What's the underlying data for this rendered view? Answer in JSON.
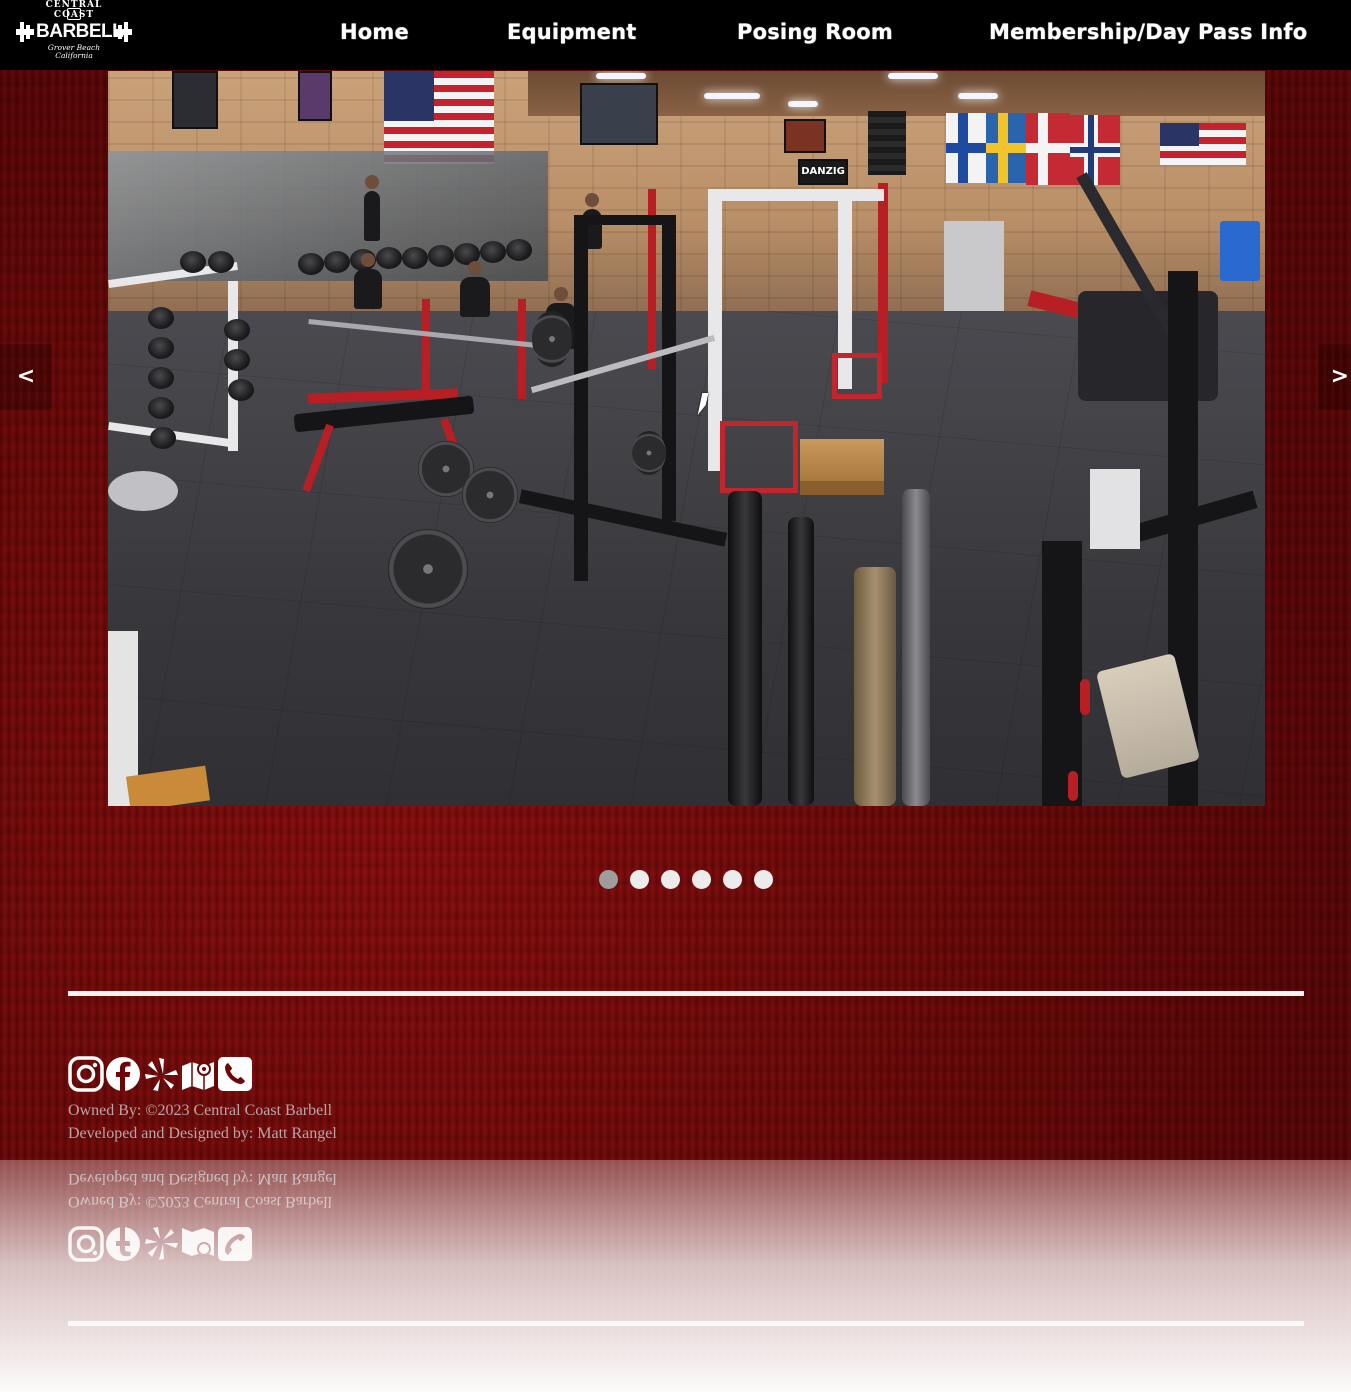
{
  "header": {
    "logo": {
      "arc_text": "CENTRAL COAST",
      "main_text": "BARBELL",
      "sub_text": "Grover Beach California"
    },
    "nav": [
      {
        "label": "Home"
      },
      {
        "label": "Equipment"
      },
      {
        "label": "Posing Room"
      },
      {
        "label": "Membership/Day Pass Info"
      }
    ]
  },
  "carousel": {
    "prev_label": "<",
    "next_label": ">",
    "slide_count": 6,
    "active_index": 0,
    "slide_banner_text": "DANZIG"
  },
  "footer": {
    "socials": [
      {
        "icon": "instagram-icon"
      },
      {
        "icon": "facebook-icon"
      },
      {
        "icon": "yelp-icon"
      },
      {
        "icon": "map-icon"
      },
      {
        "icon": "phone-icon"
      }
    ],
    "owned_by": "Owned By: ©2023 Central Coast Barbell",
    "developed_by": "Developed and Designed by: Matt Rangel"
  },
  "colors": {
    "header_bg": "#000000",
    "page_bg": "#6e0606",
    "dot_inactive": "#ececec",
    "dot_active": "#9d9d9d",
    "credits_text": "#b7a6a6"
  }
}
